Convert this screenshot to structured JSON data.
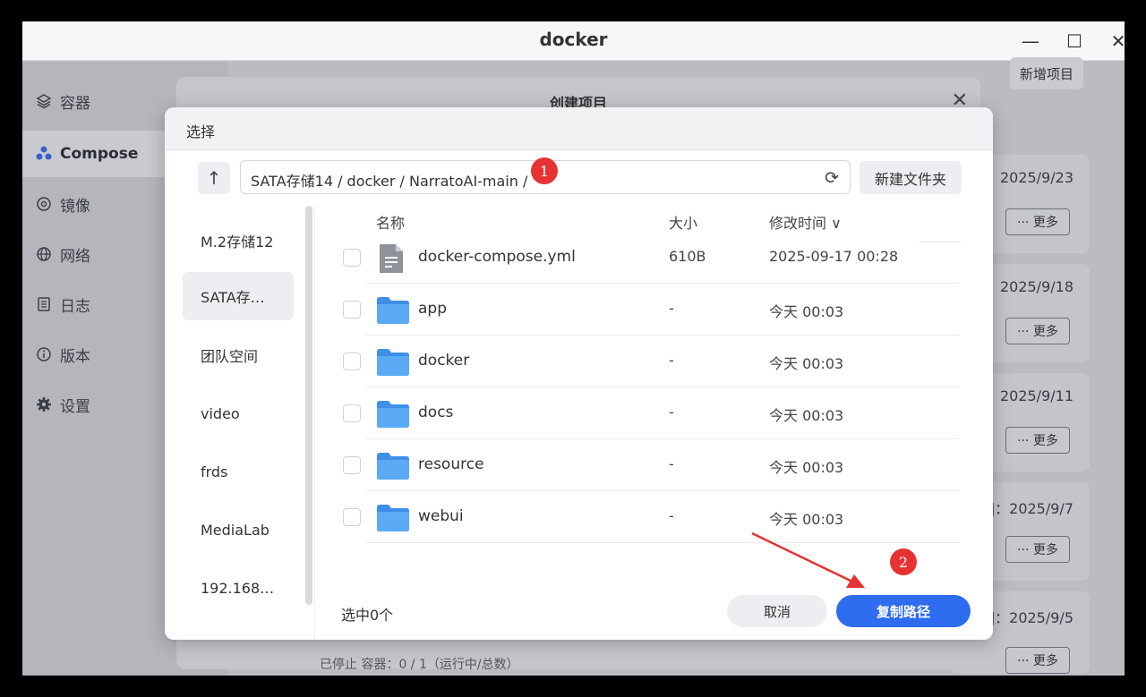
{
  "window": {
    "title": "docker",
    "minimize_glyph": "—",
    "maximize_glyph": "☐",
    "close_glyph": "✕"
  },
  "sidebar": {
    "items": [
      {
        "label": "容器",
        "icon": "layers-icon"
      },
      {
        "label": "Compose",
        "icon": "compose-icon"
      },
      {
        "label": "镜像",
        "icon": "image-icon"
      },
      {
        "label": "网络",
        "icon": "globe-icon"
      },
      {
        "label": "日志",
        "icon": "log-icon"
      },
      {
        "label": "版本",
        "icon": "info-icon"
      },
      {
        "label": "设置",
        "icon": "gear-icon"
      }
    ],
    "active": "Compose"
  },
  "main": {
    "add_project_label": "新增项目",
    "cards": [
      {
        "date": "2025/9/23",
        "more_label": "··· 更多"
      },
      {
        "date": "2025/9/18",
        "more_label": "··· 更多"
      },
      {
        "date": "2025/9/11",
        "more_label": "··· 更多"
      },
      {
        "date": "]：2025/9/7",
        "more_label": "··· 更多"
      },
      {
        "date": "]：2025/9/5",
        "more_label": "··· 更多"
      }
    ]
  },
  "create_dialog": {
    "title": "创建项目",
    "close_glyph": "✕",
    "footer_partial": "已停止 容器：0 / 1（运行中/总数）"
  },
  "picker": {
    "title": "选择",
    "up_glyph": "↑",
    "path": "SATA存储14 / docker / NarratoAI-main /",
    "refresh_glyph": "⟳",
    "new_folder_label": "新建文件夹",
    "locations": [
      "M.2存储12",
      "SATA存…",
      "团队空间",
      "video",
      "frds",
      "MediaLab",
      "192.168…"
    ],
    "active_location": "SATA存…",
    "columns": {
      "name": "名称",
      "size": "大小",
      "modified": "修改时间 ∨"
    },
    "files": [
      {
        "name": "docker-compose.yml",
        "size": "610B",
        "modified": "2025-09-17 00:28",
        "type": "file"
      },
      {
        "name": "app",
        "size": "-",
        "modified": "今天 00:03",
        "type": "folder"
      },
      {
        "name": "docker",
        "size": "-",
        "modified": "今天 00:03",
        "type": "folder"
      },
      {
        "name": "docs",
        "size": "-",
        "modified": "今天 00:03",
        "type": "folder"
      },
      {
        "name": "resource",
        "size": "-",
        "modified": "今天 00:03",
        "type": "folder"
      },
      {
        "name": "webui",
        "size": "-",
        "modified": "今天 00:03",
        "type": "folder"
      }
    ],
    "selected_count": "选中0个",
    "cancel_label": "取消",
    "copy_path_label": "复制路径"
  },
  "annotations": {
    "badge_1": "1",
    "badge_2": "2",
    "badge_color": "#e63232"
  },
  "colors": {
    "primary": "#2e6cf0",
    "folder": "#4a9ff0"
  }
}
